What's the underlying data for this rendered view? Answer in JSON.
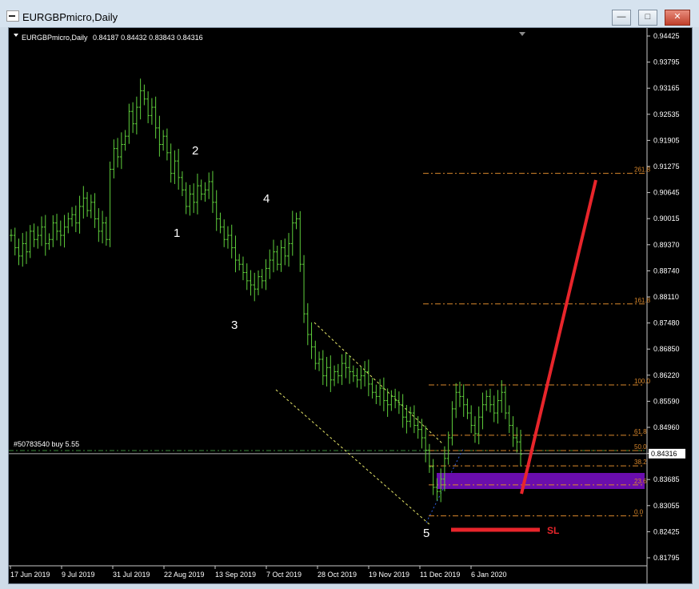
{
  "window": {
    "title": "EURGBPmicro,Daily",
    "buttons": {
      "minimize": "—",
      "maximize": "□",
      "close": "✕"
    }
  },
  "chart_info": {
    "symbol_line": "EURGBPmicro,Daily",
    "ohlc": "0.84187 0.84432 0.83843 0.84316"
  },
  "colors": {
    "background": "#000000",
    "candles": "#5fcf3c",
    "fib": "#d9882c",
    "trade": "#e8252b",
    "channel": "#e8e86a",
    "zone": "#6a0dad",
    "order_line": "#3a8a3a"
  },
  "order_label": "#50783540 buy 5.55",
  "current_price_label": "0.84316",
  "sl_label": "SL",
  "wave_labels": [
    "2",
    "1",
    "4",
    "3",
    "5"
  ],
  "chart_data": {
    "type": "ohlc",
    "title": "EURGBPmicro,Daily",
    "y_ticks": [
      "0.94425",
      "0.93795",
      "0.93165",
      "0.92535",
      "0.91905",
      "0.91275",
      "0.90645",
      "0.90015",
      "0.89370",
      "0.88740",
      "0.88110",
      "0.87480",
      "0.86850",
      "0.86220",
      "0.85590",
      "0.84960",
      "0.84330",
      "0.83685",
      "0.83055",
      "0.82425",
      "0.81795"
    ],
    "x_ticks": [
      "17 Jun 2019",
      "9 Jul 2019",
      "31 Jul 2019",
      "22 Aug 2019",
      "13 Sep 2019",
      "7 Oct 2019",
      "28 Oct 2019",
      "19 Nov 2019",
      "11 Dec 2019",
      "6 Jan 2020"
    ],
    "ylim": [
      0.81795,
      0.94425
    ],
    "close_series": [
      0.896,
      0.893,
      0.891,
      0.894,
      0.892,
      0.897,
      0.895,
      0.896,
      0.898,
      0.894,
      0.895,
      0.899,
      0.897,
      0.896,
      0.898,
      0.9,
      0.901,
      0.899,
      0.903,
      0.905,
      0.902,
      0.904,
      0.9,
      0.897,
      0.899,
      0.895,
      0.912,
      0.917,
      0.915,
      0.918,
      0.92,
      0.926,
      0.923,
      0.927,
      0.931,
      0.929,
      0.925,
      0.927,
      0.922,
      0.918,
      0.92,
      0.916,
      0.911,
      0.914,
      0.91,
      0.907,
      0.903,
      0.906,
      0.904,
      0.908,
      0.906,
      0.907,
      0.909,
      0.904,
      0.9,
      0.898,
      0.895,
      0.896,
      0.893,
      0.89,
      0.889,
      0.887,
      0.885,
      0.884,
      0.883,
      0.886,
      0.885,
      0.888,
      0.89,
      0.892,
      0.889,
      0.893,
      0.891,
      0.894,
      0.899,
      0.9,
      0.889,
      0.877,
      0.872,
      0.869,
      0.865,
      0.866,
      0.862,
      0.864,
      0.861,
      0.863,
      0.862,
      0.865,
      0.864,
      0.863,
      0.862,
      0.861,
      0.862,
      0.863,
      0.86,
      0.858,
      0.857,
      0.859,
      0.856,
      0.855,
      0.857,
      0.856,
      0.855,
      0.852,
      0.851,
      0.853,
      0.85,
      0.849,
      0.847,
      0.844,
      0.84,
      0.835,
      0.834,
      0.837,
      0.842,
      0.847,
      0.854,
      0.858,
      0.857,
      0.855,
      0.853,
      0.85,
      0.848,
      0.852,
      0.855,
      0.857,
      0.855,
      0.853,
      0.856,
      0.858,
      0.853,
      0.85,
      0.847,
      0.846,
      0.843
    ],
    "fibonacci_levels": [
      {
        "label": "261.8",
        "price": 0.911
      },
      {
        "label": "161.8",
        "price": 0.8794
      },
      {
        "label": "100.0",
        "price": 0.8598
      },
      {
        "label": "61.8",
        "price": 0.8476
      },
      {
        "label": "50.0",
        "price": 0.8439
      },
      {
        "label": "38.2",
        "price": 0.8402
      },
      {
        "label": "23.6",
        "price": 0.8356
      },
      {
        "label": "0.0",
        "price": 0.8281
      }
    ],
    "order_price": 0.8439,
    "current_price": 0.84316
  }
}
